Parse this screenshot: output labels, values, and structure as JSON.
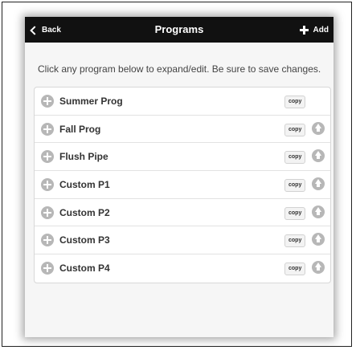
{
  "header": {
    "back_label": "Back",
    "title": "Programs",
    "add_label": "Add"
  },
  "instructions": "Click any program below to expand/edit. Be sure to save changes.",
  "programs": [
    {
      "name": "Summer Prog",
      "copy_label": "copy",
      "has_move_up": false
    },
    {
      "name": "Fall Prog",
      "copy_label": "copy",
      "has_move_up": true
    },
    {
      "name": "Flush Pipe",
      "copy_label": "copy",
      "has_move_up": true
    },
    {
      "name": "Custom P1",
      "copy_label": "copy",
      "has_move_up": true
    },
    {
      "name": "Custom P2",
      "copy_label": "copy",
      "has_move_up": true
    },
    {
      "name": "Custom P3",
      "copy_label": "copy",
      "has_move_up": true
    },
    {
      "name": "Custom P4",
      "copy_label": "copy",
      "has_move_up": true
    }
  ],
  "icons": {
    "back": "chevron-left-icon",
    "add": "plus-icon",
    "expand": "plus-circle-icon",
    "move_up": "arrow-up-circle-icon"
  },
  "colors": {
    "header_bg": "#111111",
    "icon_gray": "#b7b7b7"
  }
}
